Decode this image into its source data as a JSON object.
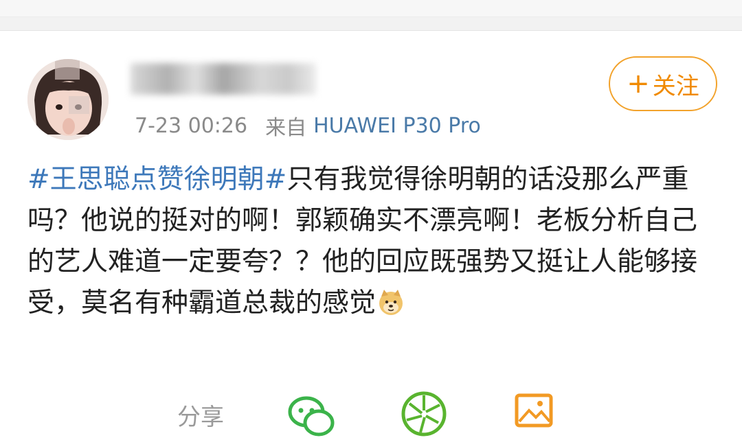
{
  "header": {
    "username_hidden": "",
    "time": "7-23 00:26",
    "from_label": "来自",
    "device": "HUAWEI P30 Pro",
    "follow_plus": "+",
    "follow_label": "关注"
  },
  "post": {
    "hashtag": "#王思聪点赞徐明朝#",
    "body": "只有我觉得徐明朝的话没那么严重吗？他说的挺对的啊！郭颖确实不漂亮啊！老板分析自己的艺人难道一定要夸？？他的回应既强势又挺让人能够接受，莫名有种霸道总裁的感觉",
    "emoji": "doge-emoji"
  },
  "actions": {
    "share_label": "分享",
    "icons": [
      "wechat-icon",
      "moments-icon",
      "image-icon"
    ]
  },
  "colors": {
    "accent": "#f08a00",
    "link": "#3d78ba",
    "meta": "#8a8a8a"
  }
}
